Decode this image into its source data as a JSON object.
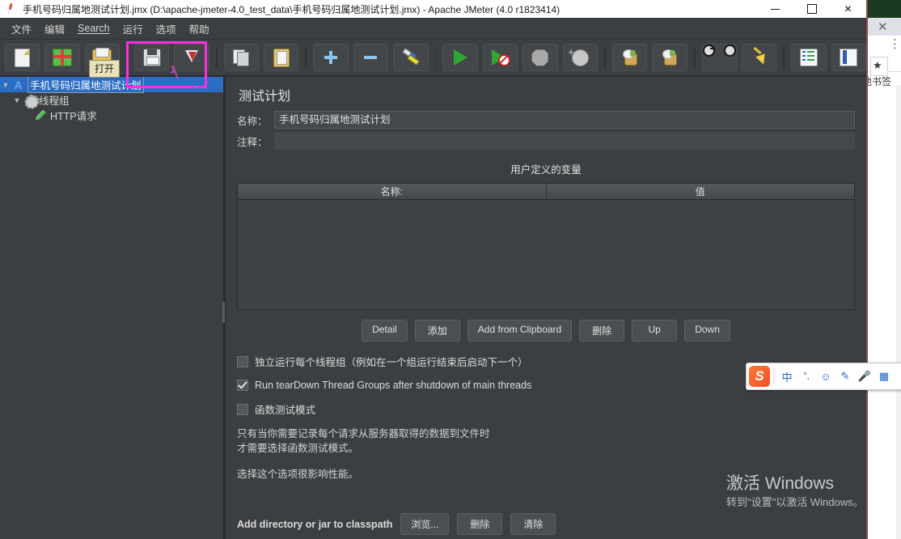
{
  "window": {
    "title": "手机号码归属地测试计划.jmx (D:\\apache-jmeter-4.0_test_data\\手机号码归属地测试计划.jmx) - Apache JMeter (4.0 r1823414)",
    "app_icon": "jmeter-feather-icon",
    "controls": {
      "minimize": "–",
      "maximize": "□",
      "close": "✕"
    }
  },
  "menubar": {
    "items": [
      {
        "label": "文件",
        "name": "menu-file"
      },
      {
        "label": "编辑",
        "name": "menu-edit"
      },
      {
        "label": "Search",
        "name": "menu-search",
        "mnemonic": true
      },
      {
        "label": "运行",
        "name": "menu-run"
      },
      {
        "label": "选项",
        "name": "menu-options"
      },
      {
        "label": "帮助",
        "name": "menu-help"
      }
    ]
  },
  "toolbar": {
    "tooltip": "打开",
    "buttons": [
      {
        "icon": "new-test-plan-icon",
        "name": "toolbar-new"
      },
      {
        "icon": "templates-icon",
        "name": "toolbar-templates"
      },
      {
        "icon": "open-folder-icon",
        "name": "toolbar-open"
      },
      {
        "icon": "save-icon",
        "name": "toolbar-save"
      },
      {
        "icon": "save-as-icon",
        "name": "toolbar-save-as"
      },
      {
        "icon": "copy-icon",
        "name": "toolbar-copy"
      },
      {
        "icon": "paste-icon",
        "name": "toolbar-paste"
      },
      {
        "icon": "expand-all-icon",
        "name": "toolbar-expand"
      },
      {
        "icon": "collapse-all-icon",
        "name": "toolbar-collapse"
      },
      {
        "icon": "toggle-icon",
        "name": "toolbar-toggle"
      },
      {
        "icon": "start-icon",
        "name": "toolbar-start"
      },
      {
        "icon": "start-no-pauses-icon",
        "name": "toolbar-start-no-pauses"
      },
      {
        "icon": "stop-icon",
        "name": "toolbar-stop"
      },
      {
        "icon": "shutdown-icon",
        "name": "toolbar-shutdown"
      },
      {
        "icon": "clear-icon",
        "name": "toolbar-clear"
      },
      {
        "icon": "clear-all-icon",
        "name": "toolbar-clear-all"
      },
      {
        "icon": "search-icon",
        "name": "toolbar-search"
      },
      {
        "icon": "reset-search-icon",
        "name": "toolbar-reset-search"
      },
      {
        "icon": "function-helper-icon",
        "name": "toolbar-function-helper"
      },
      {
        "icon": "help-icon",
        "name": "toolbar-help"
      }
    ]
  },
  "annotation": {
    "label": "1",
    "color": "#ff2fe0"
  },
  "tree": {
    "nodes": [
      {
        "label": "手机号码归属地测试计划",
        "icon": "test-plan-icon",
        "selected": true,
        "editing": true,
        "depth": 0,
        "expanded": true
      },
      {
        "label": "线程组",
        "icon": "thread-group-icon",
        "selected": false,
        "depth": 1,
        "expanded": true
      },
      {
        "label": "HTTP请求",
        "icon": "http-request-icon",
        "selected": false,
        "depth": 2,
        "expanded": false
      }
    ]
  },
  "main": {
    "panel_title": "测试计划",
    "name_label": "名称：",
    "name_value": "手机号码归属地测试计划",
    "comment_label": "注释：",
    "comment_value": "",
    "variables_title": "用户定义的变量",
    "table": {
      "columns": [
        "名称:",
        "值"
      ],
      "rows": []
    },
    "table_buttons": [
      {
        "label": "Detail",
        "name": "detail-button"
      },
      {
        "label": "添加",
        "name": "add-button"
      },
      {
        "label": "Add from Clipboard",
        "name": "add-from-clipboard-button"
      },
      {
        "label": "删除",
        "name": "delete-button"
      },
      {
        "label": "Up",
        "name": "up-button"
      },
      {
        "label": "Down",
        "name": "down-button"
      }
    ],
    "checkboxes": [
      {
        "label": "独立运行每个线程组（例如在一个组运行结束后启动下一个）",
        "checked": false,
        "name": "serialize-thread-groups-checkbox"
      },
      {
        "label": "Run tearDown Thread Groups after shutdown of main threads",
        "checked": true,
        "name": "run-teardown-checkbox"
      },
      {
        "label": "函数测试模式",
        "checked": false,
        "name": "functional-test-mode-checkbox"
      }
    ],
    "description": [
      "只有当你需要记录每个请求从服务器取得的数据到文件时",
      "才需要选择函数测试模式。",
      "",
      "选择这个选项很影响性能。"
    ],
    "classpath_label": "Add directory or jar to classpath",
    "classpath_buttons": [
      {
        "label": "浏览...",
        "name": "browse-button"
      },
      {
        "label": "删除",
        "name": "classpath-delete-button"
      },
      {
        "label": "清除",
        "name": "classpath-clear-button"
      }
    ]
  },
  "ime": {
    "name": "sogou-input-method",
    "logo": "S",
    "items": [
      {
        "glyph": "中",
        "name": "ime-chinese-mode-icon"
      },
      {
        "glyph": "°,",
        "name": "ime-punctuation-icon"
      },
      {
        "glyph": "☺",
        "name": "ime-emoji-icon"
      },
      {
        "glyph": "✎",
        "name": "ime-handwriting-icon"
      },
      {
        "glyph": "🎤",
        "name": "ime-voice-icon"
      },
      {
        "glyph": "▦",
        "name": "ime-toolbox-icon"
      }
    ]
  },
  "watermark": {
    "line1": "激活 Windows",
    "line2": "转到\"设置\"以激活 Windows。"
  },
  "background_browser": {
    "bookmarks_label": "他书签",
    "close": "✕",
    "menu": "⋮",
    "star": "★"
  }
}
